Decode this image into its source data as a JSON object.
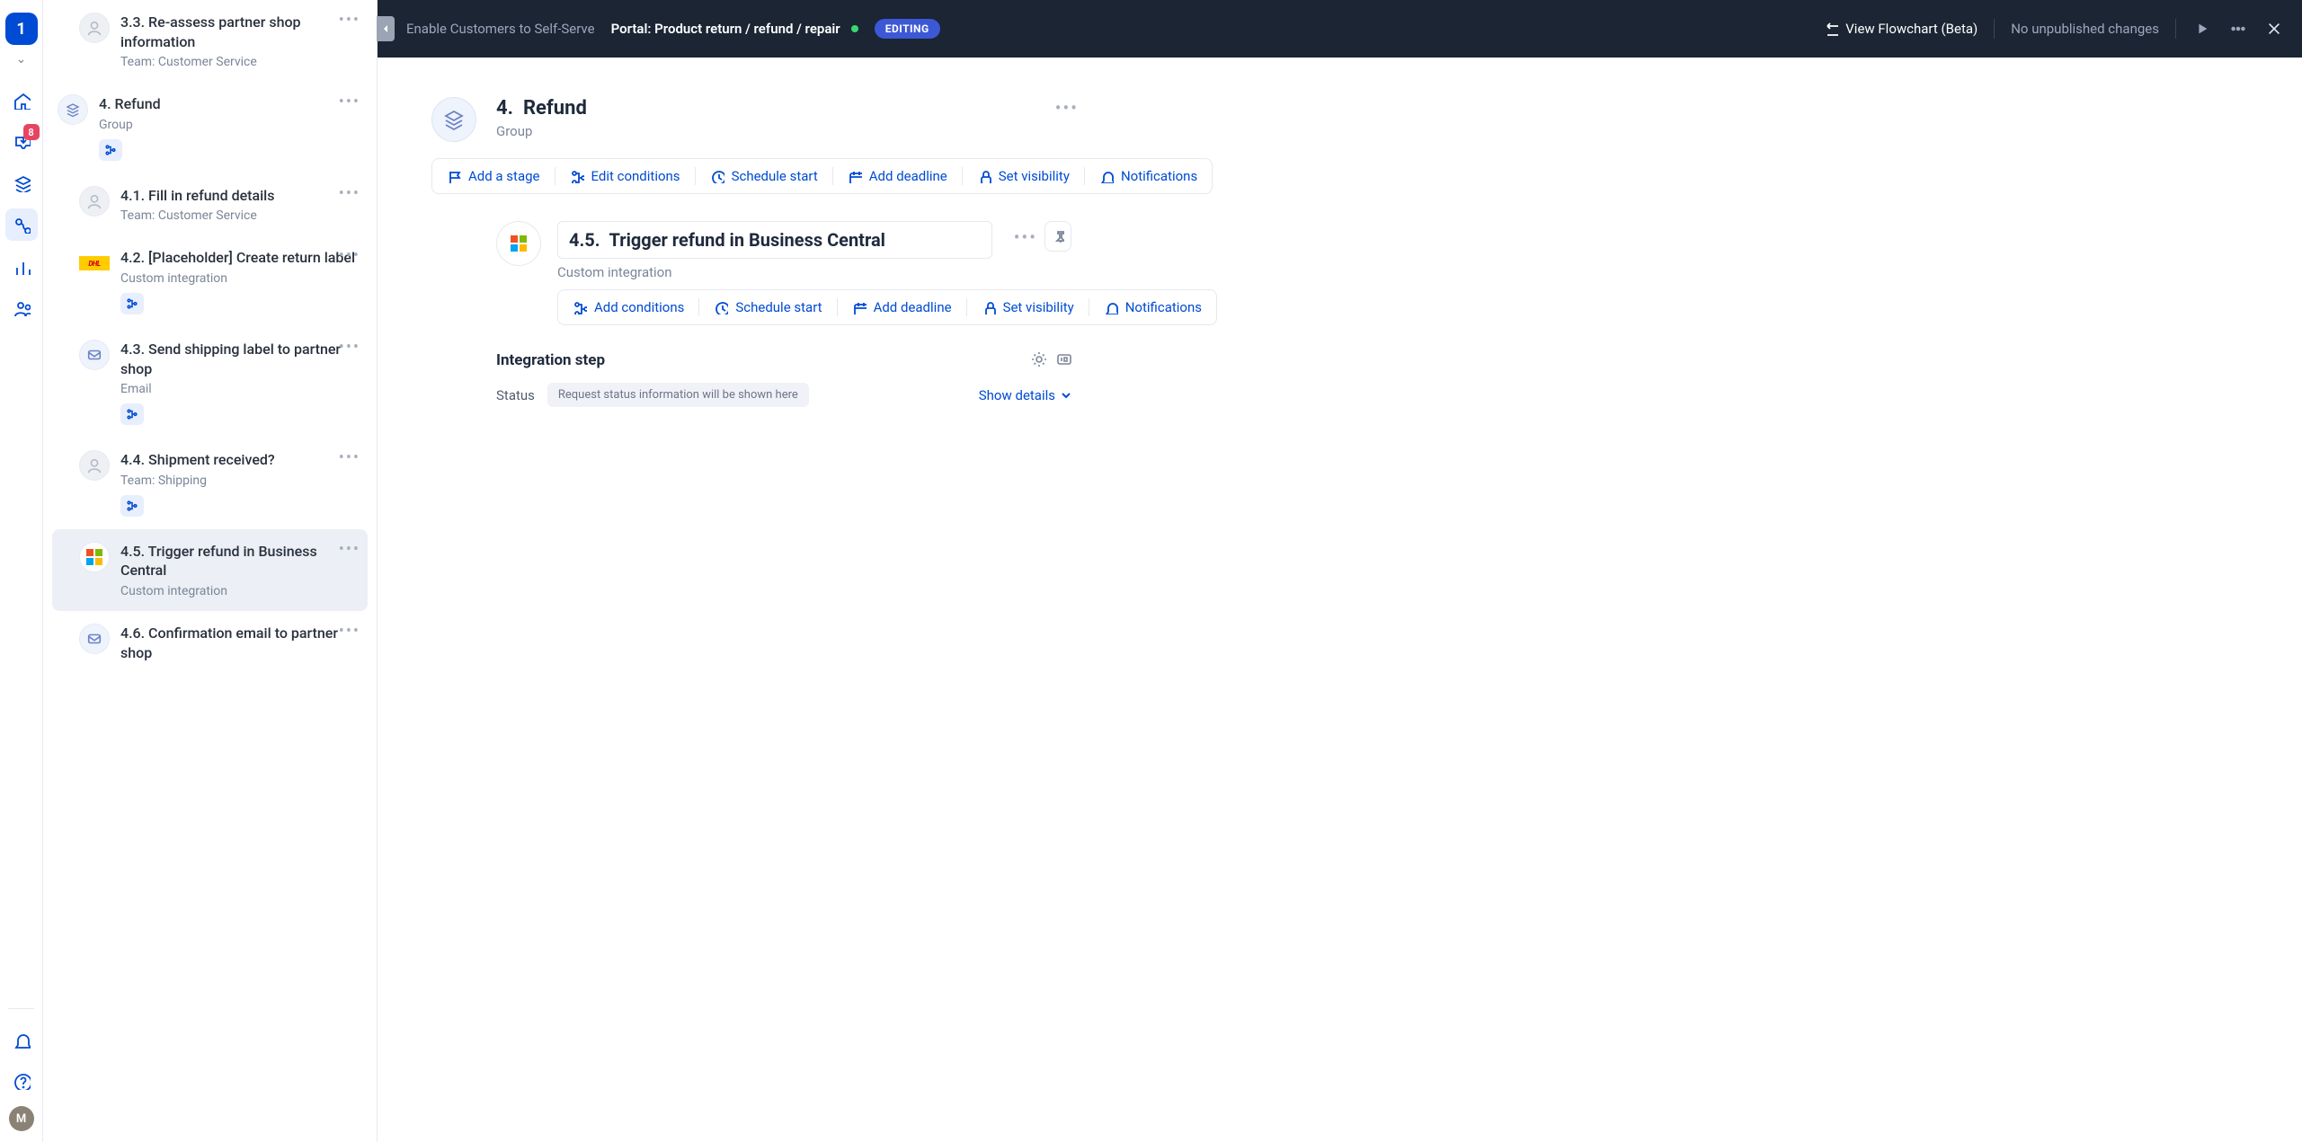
{
  "rail": {
    "logo_text": "1",
    "inbox_badge": "8",
    "avatar_initial": "M"
  },
  "topbar": {
    "back_label": "Enable Customers to Self-Serve",
    "title": "Portal: Product return / refund / repair",
    "editing_badge": "EDITING",
    "view_flowchart": "View Flowchart (Beta)",
    "no_changes": "No unpublished changes"
  },
  "steps": [
    {
      "num": "3.3.",
      "title": "Re-assess partner shop information",
      "sub": "Team: Customer Service",
      "icon": "person",
      "level": "child"
    },
    {
      "num": "4.",
      "title": "Refund",
      "sub": "Group",
      "icon": "stack",
      "level": "group",
      "has_chip": true
    },
    {
      "num": "4.1.",
      "title": "Fill in refund details",
      "sub": "Team: Customer Service",
      "icon": "person",
      "level": "child"
    },
    {
      "num": "4.2.",
      "title": "[Placeholder] Create return label",
      "sub": "Custom integration",
      "icon": "dhl",
      "level": "child",
      "has_chip": true
    },
    {
      "num": "4.3.",
      "title": "Send shipping label to partner shop",
      "sub": "Email",
      "icon": "mail",
      "level": "child",
      "has_chip": true
    },
    {
      "num": "4.4.",
      "title": "Shipment received?",
      "sub": "Team: Shipping",
      "icon": "person",
      "level": "child",
      "has_chip": true
    },
    {
      "num": "4.5.",
      "title": "Trigger refund in Business Central",
      "sub": "Custom integration",
      "icon": "ms",
      "level": "child",
      "selected": true
    },
    {
      "num": "4.6.",
      "title": "Confirmation email to partner shop",
      "sub": "",
      "icon": "mail",
      "level": "child"
    }
  ],
  "group": {
    "number": "4.",
    "title": "Refund",
    "kind": "Group",
    "actions": {
      "add_stage": "Add a stage",
      "edit_conditions": "Edit conditions",
      "schedule_start": "Schedule start",
      "add_deadline": "Add deadline",
      "set_visibility": "Set visibility",
      "notifications": "Notifications"
    }
  },
  "step_detail": {
    "number": "4.5.",
    "title": "Trigger refund in Business Central",
    "kind": "Custom integration",
    "actions": {
      "add_conditions": "Add conditions",
      "schedule_start": "Schedule start",
      "add_deadline": "Add deadline",
      "set_visibility": "Set visibility",
      "notifications": "Notifications"
    },
    "integration": {
      "heading": "Integration step",
      "status_label": "Status",
      "status_text": "Request status information will be shown here",
      "show_details": "Show details"
    }
  }
}
